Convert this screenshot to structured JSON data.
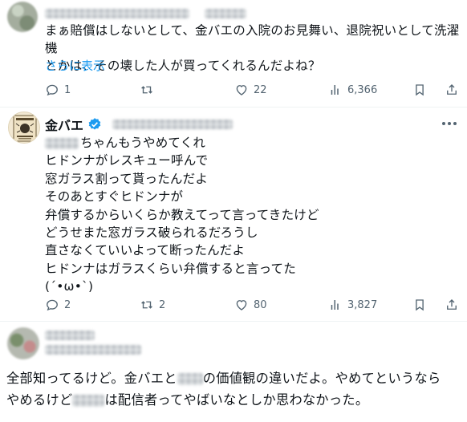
{
  "tweets": [
    {
      "text_line1": "まぁ賠償はしないとして、金バエの入院のお見舞い、退院祝いとして洗濯機",
      "text_line2": "とかは、その壊した人が買ってくれるんだよね？",
      "show_more": "さらに表示",
      "replies": "1",
      "retweets": "",
      "likes": "22",
      "views": "6,366"
    },
    {
      "name": "金バエ",
      "lines": [
        "ちゃんもうやめてくれ",
        "ヒドンナがレスキュー呼んで",
        "窓ガラス割って貰ったんだよ",
        "そのあとすぐヒドンナが",
        "弁償するからいくらか教えてって言ってきたけど",
        "どうせまた窓ガラス破られるだろうし",
        "直さなくていいよって断ったんだよ",
        "ヒドンナはガラスくらい弁償すると言ってた",
        "(´•ω•`)"
      ],
      "replies": "2",
      "retweets": "2",
      "likes": "80",
      "views": "3,827"
    },
    {
      "line1_a": "全部知ってるけど。金バエと",
      "line1_b": "の価値観の違いだよ。やめてというなら",
      "line2_a": "やめるけど",
      "line2_b": "は配信者ってやばいなとしか思わなかった。"
    }
  ],
  "colors": {
    "accent": "#1d9bf0",
    "muted": "#536471",
    "text": "#0f1419",
    "border": "#eff3f4"
  }
}
